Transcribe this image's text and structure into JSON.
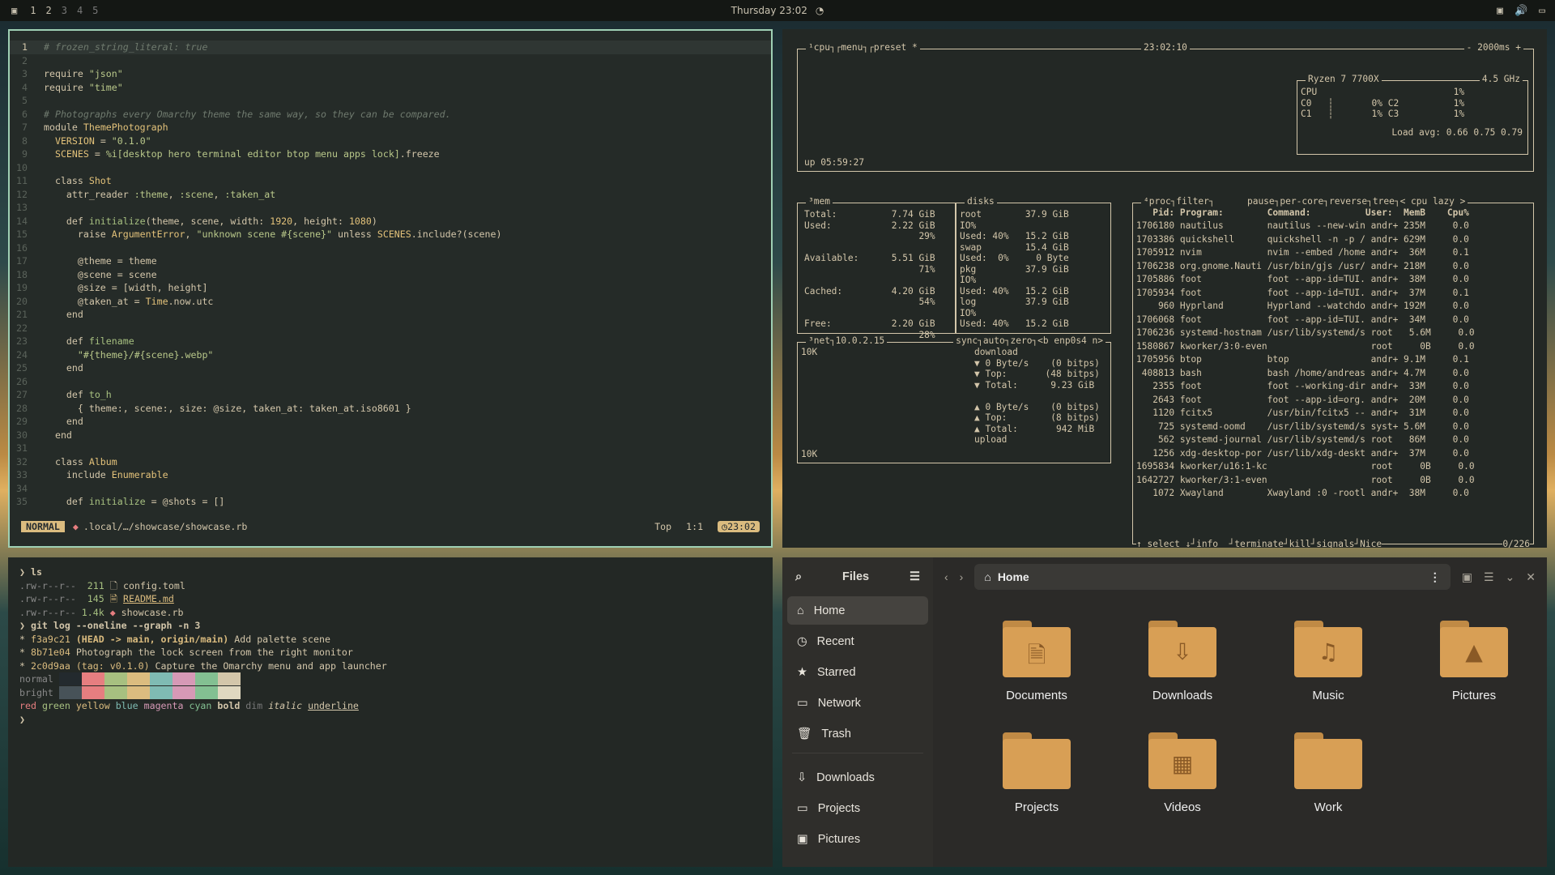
{
  "topbar": {
    "workspaces": [
      "1",
      "2",
      "3",
      "4",
      "5"
    ],
    "clock": "Thursday 23:02",
    "clock_icon": "alarm-icon",
    "tray": [
      "screen-icon",
      "volume-icon",
      "network-icon"
    ]
  },
  "editor": {
    "lines": [
      {
        "n": "1",
        "html": "<span class='c-com'># frozen_string_literal: true</span>"
      },
      {
        "n": "2",
        "html": ""
      },
      {
        "n": "3",
        "html": "require <span class='c-str'>\"json\"</span>"
      },
      {
        "n": "4",
        "html": "require <span class='c-str'>\"time\"</span>"
      },
      {
        "n": "5",
        "html": ""
      },
      {
        "n": "6",
        "html": "<span class='c-com'># Photographs every Omarchy theme the same way, so they can be compared.</span>"
      },
      {
        "n": "7",
        "html": "module <span class='c-const'>ThemePhotograph</span>"
      },
      {
        "n": "8",
        "html": "  <span class='c-const'>VERSION</span> = <span class='c-str'>\"0.1.0\"</span>"
      },
      {
        "n": "9",
        "html": "  <span class='c-const'>SCENES</span> = <span class='c-str'>%i[desktop hero terminal editor btop menu apps lock]</span>.freeze"
      },
      {
        "n": "10",
        "html": ""
      },
      {
        "n": "11",
        "html": "  class <span class='c-const'>Shot</span>"
      },
      {
        "n": "12",
        "html": "    attr_reader <span class='c-str'>:theme</span>, <span class='c-str'>:scene</span>, <span class='c-str'>:taken_at</span>"
      },
      {
        "n": "13",
        "html": ""
      },
      {
        "n": "14",
        "html": "    def <span class='c-def'>initialize</span>(theme, scene, width: <span class='c-const'>1920</span>, height: <span class='c-const'>1080</span>)"
      },
      {
        "n": "15",
        "html": "      raise <span class='c-const'>ArgumentError</span>, <span class='c-str'>\"unknown scene #{scene}\"</span> unless <span class='c-const'>SCENES</span>.include?(scene)"
      },
      {
        "n": "16",
        "html": ""
      },
      {
        "n": "17",
        "html": "      @theme = theme"
      },
      {
        "n": "18",
        "html": "      @scene = scene"
      },
      {
        "n": "19",
        "html": "      @size = [width, height]"
      },
      {
        "n": "20",
        "html": "      @taken_at = <span class='c-const'>Time</span>.now.utc"
      },
      {
        "n": "21",
        "html": "    end"
      },
      {
        "n": "22",
        "html": ""
      },
      {
        "n": "23",
        "html": "    def <span class='c-def'>filename</span>"
      },
      {
        "n": "24",
        "html": "      <span class='c-str'>\"#{theme}/#{scene}.webp\"</span>"
      },
      {
        "n": "25",
        "html": "    end"
      },
      {
        "n": "26",
        "html": ""
      },
      {
        "n": "27",
        "html": "    def <span class='c-def'>to_h</span>"
      },
      {
        "n": "28",
        "html": "      { theme:, scene:, size: @size, taken_at: taken_at.iso8601 }"
      },
      {
        "n": "29",
        "html": "    end"
      },
      {
        "n": "30",
        "html": "  end"
      },
      {
        "n": "31",
        "html": ""
      },
      {
        "n": "32",
        "html": "  class <span class='c-const'>Album</span>"
      },
      {
        "n": "33",
        "html": "    include <span class='c-const'>Enumerable</span>"
      },
      {
        "n": "34",
        "html": ""
      },
      {
        "n": "35",
        "html": "    def <span class='c-def'>initialize</span> = @shots = []"
      }
    ],
    "status": {
      "mode": "NORMAL",
      "file": ".local/…/showcase/showcase.rb",
      "pos": "Top",
      "cursor": "1:1",
      "time": "23:02"
    }
  },
  "btop": {
    "cpu_header": "¹cpu┐┌menu┐┌preset *",
    "clock": "23:02:10",
    "interval": "- 2000ms +",
    "uptime": "up 05:59:27",
    "cpu_model": "Ryzen 7 7700X",
    "cpu_freq": "4.5 GHz",
    "cpu_rows": [
      "CPU                         1%",
      "C0   ┆       0% C2          1%",
      "C1   ┆       1% C3          1%"
    ],
    "load": "Load avg: 0.66 0.75 0.79",
    "mem_header": "³mem",
    "mem_rows": [
      "Total:          7.74 GiB",
      "Used:           2.22 GiB",
      "                     29%",
      "",
      "Available:      5.51 GiB",
      "                     71%",
      "",
      "Cached:         4.20 GiB",
      "                     54%",
      "",
      "Free:           2.20 GiB",
      "                     28%"
    ],
    "disk_header": "disks",
    "disk_rows": [
      "root        37.9 GiB",
      "IO%",
      "Used: 40%   15.2 GiB",
      "swap        15.4 GiB",
      "Used:  0%     0 Byte",
      "pkg         37.9 GiB",
      "IO%",
      "Used: 40%   15.2 GiB",
      "log         37.9 GiB",
      "IO%",
      "Used: 40%   15.2 GiB"
    ],
    "net_header": "³net┐10.0.2.15",
    "net_opts": "sync┐auto┐zero┐<b enp0s4 n>",
    "net_rows": [
      "download",
      "▼ 0 Byte/s    (0 bitps)",
      "▼ Top:       (48 bitps)",
      "▼ Total:      9.23 GiB",
      "",
      "▲ 0 Byte/s    (0 bitps)",
      "▲ Top:        (8 bitps)",
      "▲ Total:       942 MiB",
      "upload"
    ],
    "net_scale": [
      "10K",
      "10K"
    ],
    "proc_header": "⁴proc┐filter┐      pause┐per-core┐reverse┐tree┐< cpu lazy >",
    "proc_cols": "   Pid: Program:        Command:          User:  MemB    Cpu%",
    "procs": [
      "1706180 nautilus        nautilus --new-win andr+ 235M     0.0",
      "1703386 quickshell      quickshell -n -p / andr+ 629M     0.0",
      "1705912 nvim            nvim --embed /home andr+  36M     0.1",
      "1706238 org.gnome.Nauti /usr/bin/gjs /usr/ andr+ 218M     0.0",
      "1705886 foot            foot --app-id=TUI. andr+  38M     0.0",
      "1705934 foot            foot --app-id=TUI. andr+  37M     0.1",
      "    960 Hyprland        Hyprland --watchdo andr+ 192M     0.0",
      "1706068 foot            foot --app-id=TUI. andr+  34M     0.0",
      "1706236 systemd-hostnam /usr/lib/systemd/s root   5.6M     0.0",
      "1580867 kworker/3:0-even                   root     0B     0.0",
      "1705956 btop            btop               andr+ 9.1M     0.1",
      " 408813 bash            bash /home/andreas andr+ 4.7M     0.0",
      "   2355 foot            foot --working-dir andr+  33M     0.0",
      "   2643 foot            foot --app-id=org. andr+  20M     0.0",
      "   1120 fcitx5          /usr/bin/fcitx5 -- andr+  31M     0.0",
      "    725 systemd-oomd    /usr/lib/systemd/s syst+ 5.6M     0.0",
      "    562 systemd-journal /usr/lib/systemd/s root   86M     0.0",
      "   1256 xdg-desktop-por /usr/lib/xdg-deskt andr+  37M     0.0",
      "1695834 kworker/u16:1-kc                   root     0B     0.0",
      "1642727 kworker/3:1-even                   root     0B     0.0",
      "   1072 Xwayland        Xwayland :0 -rootl andr+  38M     0.0"
    ],
    "proc_footer": "↑ select ↓┘info  ┘terminate┘kill┘signals┘Nice",
    "proc_count": "0/226"
  },
  "terminal": {
    "lines": [
      {
        "html": "<span style='color:#d3c6aa'>❯ </span><b>ls</b>"
      },
      {
        "html": "<span style='color:#888'>.rw-r--r--</span>  <span style='color:#a7c080'>211</span> 🗋 config.toml"
      },
      {
        "html": "<span style='color:#888'>.rw-r--r--</span>  <span style='color:#a7c080'>145</span> <span style='color:#dbbc7f'>🗎</span> <u style='color:#dbbc7f'>README.md</u>"
      },
      {
        "html": "<span style='color:#888'>.rw-r--r--</span> <span style='color:#a7c080'>1.4k</span> <span style='color:#e67e80'>◆</span> showcase.rb"
      },
      {
        "html": "<span style='color:#d3c6aa'>❯ </span><b>git log --oneline --graph -n 3</b>"
      },
      {
        "html": "* <span style='color:#dbbc7f'>f3a9c21</span> <b style='color:#dbbc7f'>(HEAD -> main, origin/main)</b> Add palette scene"
      },
      {
        "html": "* <span style='color:#dbbc7f'>8b71e04</span> Photograph the lock screen from the right monitor"
      },
      {
        "html": "* <span style='color:#dbbc7f'>2c0d9aa</span> <span style='color:#dbbc7f'>(tag: v0.1.0)</span> Capture the Omarchy menu and app launcher"
      },
      {
        "html": "<span style='color:#888'>normal </span>"
      },
      {
        "html": "<span style='color:#888'>bright </span>"
      },
      {
        "html": "<span style='color:#e67e80'>red</span> <span style='color:#a7c080'>green</span> <span style='color:#dbbc7f'>yellow</span> <span style='color:#7fbbb3'>blue</span> <span style='color:#d699b6'>magenta</span> <span style='color:#83c092'>cyan</span> <b>bold</b> <span style='color:#777'>dim</span> <i>italic</i> <u>underline</u>"
      },
      {
        "html": "<span style='color:#d3c6aa'>❯</span>"
      }
    ],
    "palette_normal": [
      "#232a2e",
      "#e67e80",
      "#a7c080",
      "#dbbc7f",
      "#7fbbb3",
      "#d699b6",
      "#83c092",
      "#d3c6aa"
    ],
    "palette_bright": [
      "#475258",
      "#e67e80",
      "#a7c080",
      "#dbbc7f",
      "#7fbbb3",
      "#d699b6",
      "#83c092",
      "#e0d8c0"
    ]
  },
  "files": {
    "title": "Files",
    "path": "Home",
    "sidebar": [
      {
        "icon": "⌂",
        "icon_name": "home-icon",
        "label": "Home",
        "selected": true
      },
      {
        "icon": "◷",
        "icon_name": "clock-icon",
        "label": "Recent"
      },
      {
        "icon": "★",
        "icon_name": "star-icon",
        "label": "Starred"
      },
      {
        "icon": "▭",
        "icon_name": "network-icon",
        "label": "Network"
      },
      {
        "icon": "🗑",
        "icon_name": "trash-icon",
        "label": "Trash"
      }
    ],
    "bookmarks": [
      {
        "icon": "⇩",
        "icon_name": "downloads-icon",
        "label": "Downloads"
      },
      {
        "icon": "▭",
        "icon_name": "folder-icon",
        "label": "Projects"
      },
      {
        "icon": "▣",
        "icon_name": "pictures-icon",
        "label": "Pictures"
      }
    ],
    "folders": [
      {
        "label": "Documents",
        "glyph": "🗎"
      },
      {
        "label": "Downloads",
        "glyph": "⇩"
      },
      {
        "label": "Music",
        "glyph": "♫"
      },
      {
        "label": "Pictures",
        "glyph": "▲"
      },
      {
        "label": "Projects",
        "glyph": ""
      },
      {
        "label": "Videos",
        "glyph": "▦"
      },
      {
        "label": "Work",
        "glyph": ""
      }
    ]
  }
}
